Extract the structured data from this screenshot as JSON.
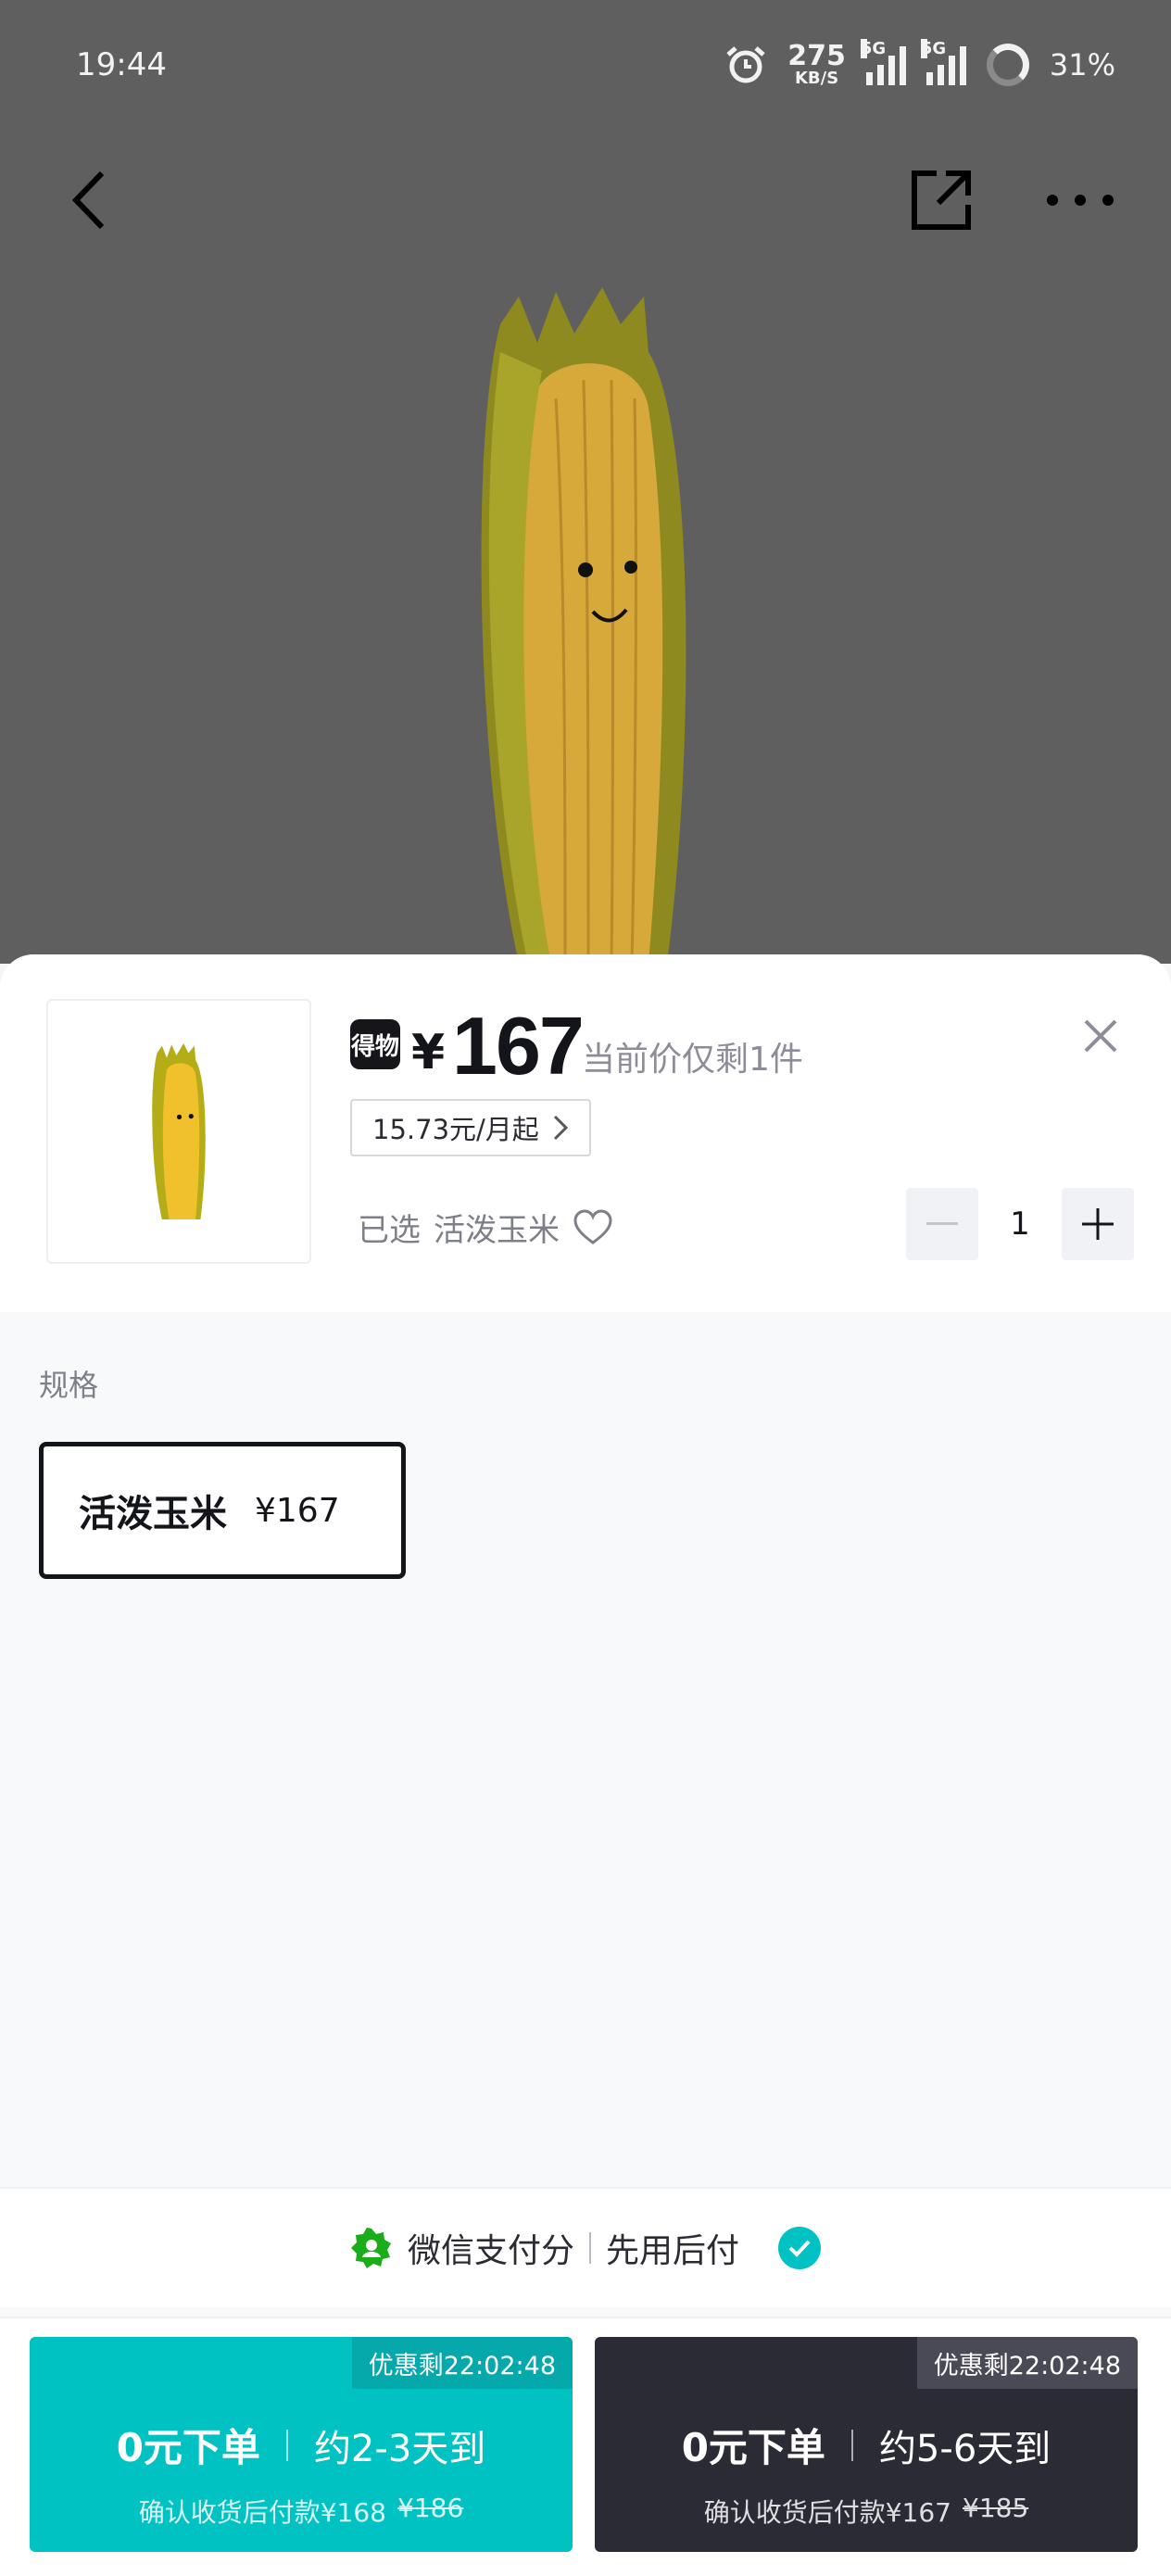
{
  "status_bar": {
    "time": "19:44",
    "net_speed": "275",
    "net_unit": "KB/S",
    "sig1": "5G",
    "sig2": "5G",
    "battery": "31%"
  },
  "product": {
    "brand_badge": "得物",
    "currency": "¥",
    "price": "167",
    "stock_note": "当前价仅剩1件",
    "installment": "15.73元/月起",
    "selected_label": "已选",
    "selected_value": "活泼玉米",
    "quantity": "1"
  },
  "spec": {
    "label": "规格",
    "options": [
      {
        "name": "活泼玉米",
        "price": "¥167"
      }
    ]
  },
  "payment": {
    "provider": "微信支付分",
    "feature": "先用后付"
  },
  "actions": {
    "option_a": {
      "countdown": "优惠剩22:02:48",
      "title": "0元下单",
      "eta": "约2-3天到",
      "note": "确认收货后付款¥168",
      "original": "¥186"
    },
    "option_b": {
      "countdown": "优惠剩22:02:48",
      "title": "0元下单",
      "eta": "约5-6天到",
      "note": "确认收货后付款¥167",
      "original": "¥185"
    }
  },
  "colors": {
    "accent_teal": "#01c2c3",
    "dark_button": "#2b2b36",
    "wechat_green": "#1aad19"
  }
}
